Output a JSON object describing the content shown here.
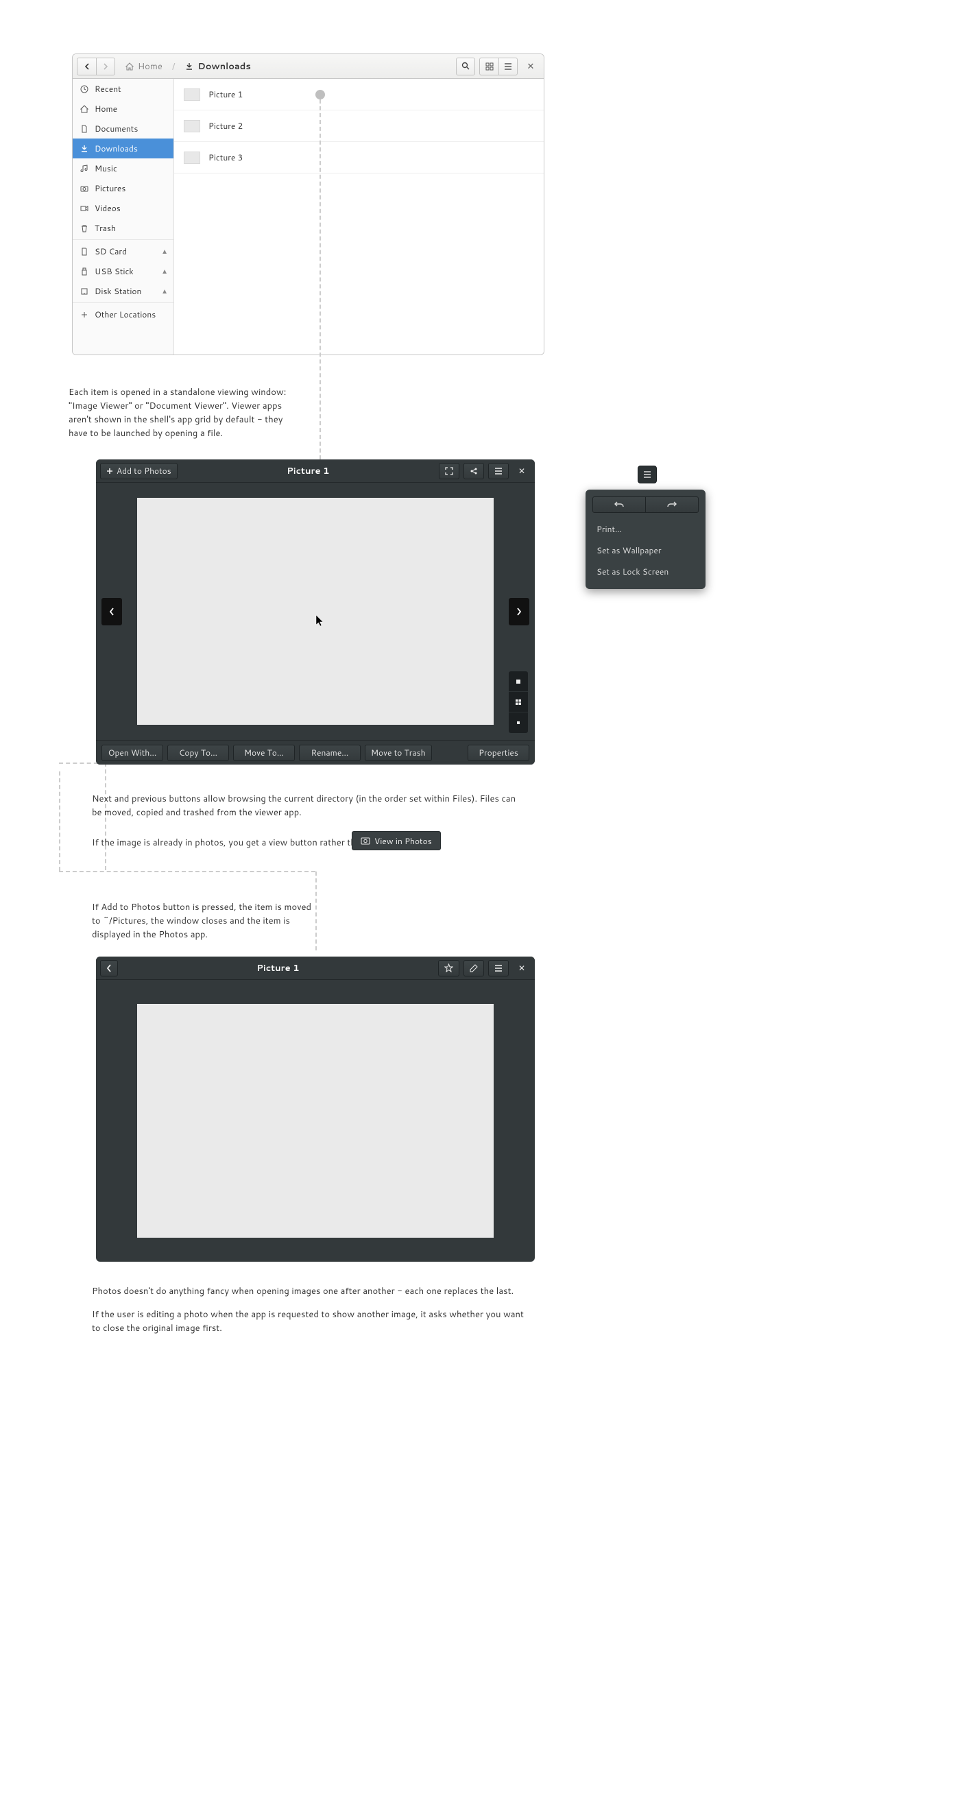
{
  "files": {
    "path": {
      "home": "Home",
      "current": "Downloads"
    },
    "sidebar": [
      {
        "label": "Recent",
        "icon": "clock"
      },
      {
        "label": "Home",
        "icon": "home"
      },
      {
        "label": "Documents",
        "icon": "doc"
      },
      {
        "label": "Downloads",
        "icon": "download",
        "selected": true
      },
      {
        "label": "Music",
        "icon": "music"
      },
      {
        "label": "Pictures",
        "icon": "camera"
      },
      {
        "label": "Videos",
        "icon": "video"
      },
      {
        "label": "Trash",
        "icon": "trash"
      }
    ],
    "devices": [
      {
        "label": "SD Card",
        "icon": "sd",
        "eject": true
      },
      {
        "label": "USB Stick",
        "icon": "usb",
        "eject": true
      },
      {
        "label": "Disk Station",
        "icon": "nas",
        "eject": true
      }
    ],
    "other_locations": "Other Locations",
    "items": [
      {
        "name": "Picture 1"
      },
      {
        "name": "Picture 2"
      },
      {
        "name": "Picture 3"
      }
    ]
  },
  "notes": {
    "n1": "Each item is opened in a standalone viewing window: \"Image Viewer\" or \"Document Viewer\". Viewer apps aren't shown in the shell's app grid by default - they have to be launched by opening a file.",
    "n2": "Next and previous buttons allow browsing the current directory (in the order set within Files). Files can be moved, copied and trashed from the viewer app.",
    "n3": "If the image is already in photos, you get a view button rather than an add one:",
    "n4": "If Add to Photos button is pressed, the item is moved to ~/Pictures, the window closes and the item is displayed in the Photos app.",
    "n5a": "Photos doesn't do anything fancy when opening images one after another - each one replaces the last.",
    "n5b": "If the user is editing a photo when the app is requested to show another image, it asks whether you want to close the original image first."
  },
  "viewer": {
    "add_to_photos": "Add to Photos",
    "title": "Picture 1",
    "footer": {
      "open_with": "Open With…",
      "copy_to": "Copy To…",
      "move_to": "Move To…",
      "rename": "Rename…",
      "trash": "Move to Trash",
      "properties": "Properties"
    }
  },
  "popover": {
    "print": "Print…",
    "wallpaper": "Set as Wallpaper",
    "lockscreen": "Set as Lock Screen"
  },
  "view_in_photos": "View in Photos",
  "photos": {
    "title": "Picture 1"
  }
}
